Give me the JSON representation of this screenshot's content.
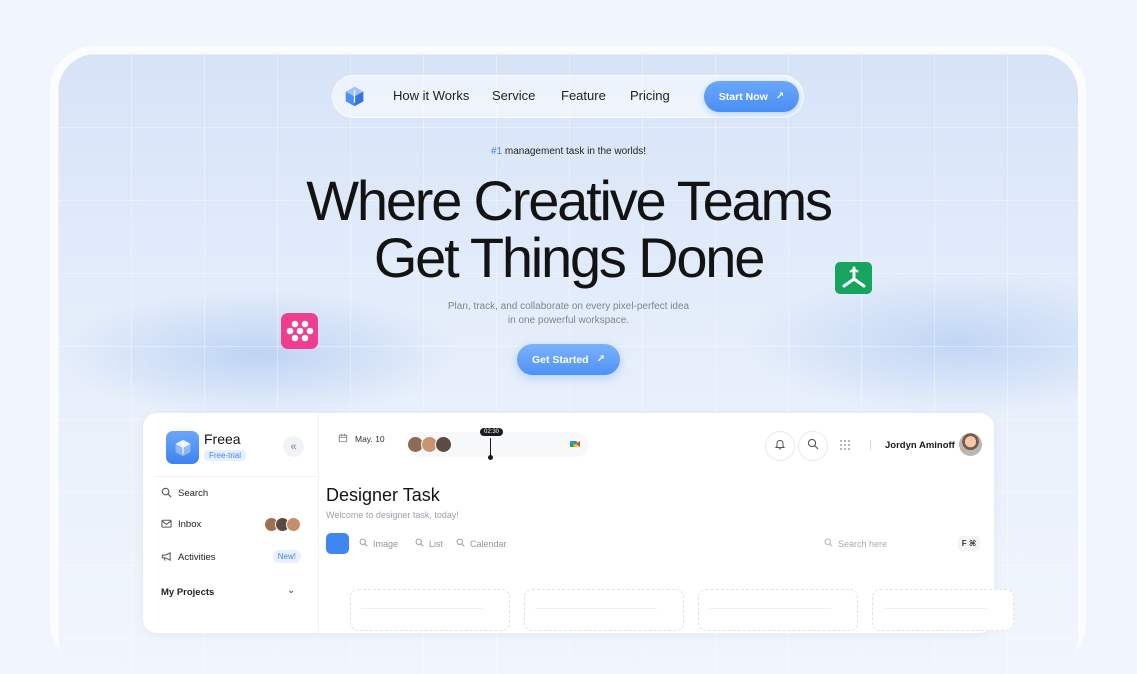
{
  "nav": {
    "links": [
      "How it Works",
      "Service",
      "Feature",
      "Pricing"
    ],
    "cta_label": "Start Now"
  },
  "hero": {
    "tag_accent": "#1",
    "tag_text": "management task in the worlds!",
    "headline_line1": "Where Creative Teams",
    "headline_line2": "Get Things Done",
    "subtitle_line1": "Plan, track, and collaborate on every pixel-perfect idea",
    "subtitle_line2": "in one powerful workspace.",
    "cta_label": "Get Started"
  },
  "app": {
    "name": "Freea",
    "plan_badge": "Free-trial",
    "sidebar": {
      "items": [
        {
          "label": "Search",
          "icon": "search-icon"
        },
        {
          "label": "Inbox",
          "icon": "mail-icon"
        },
        {
          "label": "Activities",
          "icon": "megaphone-icon",
          "badge": "New!"
        }
      ],
      "projects_label": "My Projects"
    },
    "topbar": {
      "date": "May. 10",
      "time_marker": "02:30",
      "user_name": "Jordyn Aminoff"
    },
    "page": {
      "title": "Designer Task",
      "subtitle": "Welcome to designer task, today!",
      "views": [
        "Image",
        "List",
        "Calendar"
      ],
      "search_placeholder": "Search here",
      "shortcut": "F ⌘"
    }
  },
  "colors": {
    "accent": "#3f86f0",
    "pink_badge": "#ef3d8f",
    "green_badge": "#16a45f"
  }
}
